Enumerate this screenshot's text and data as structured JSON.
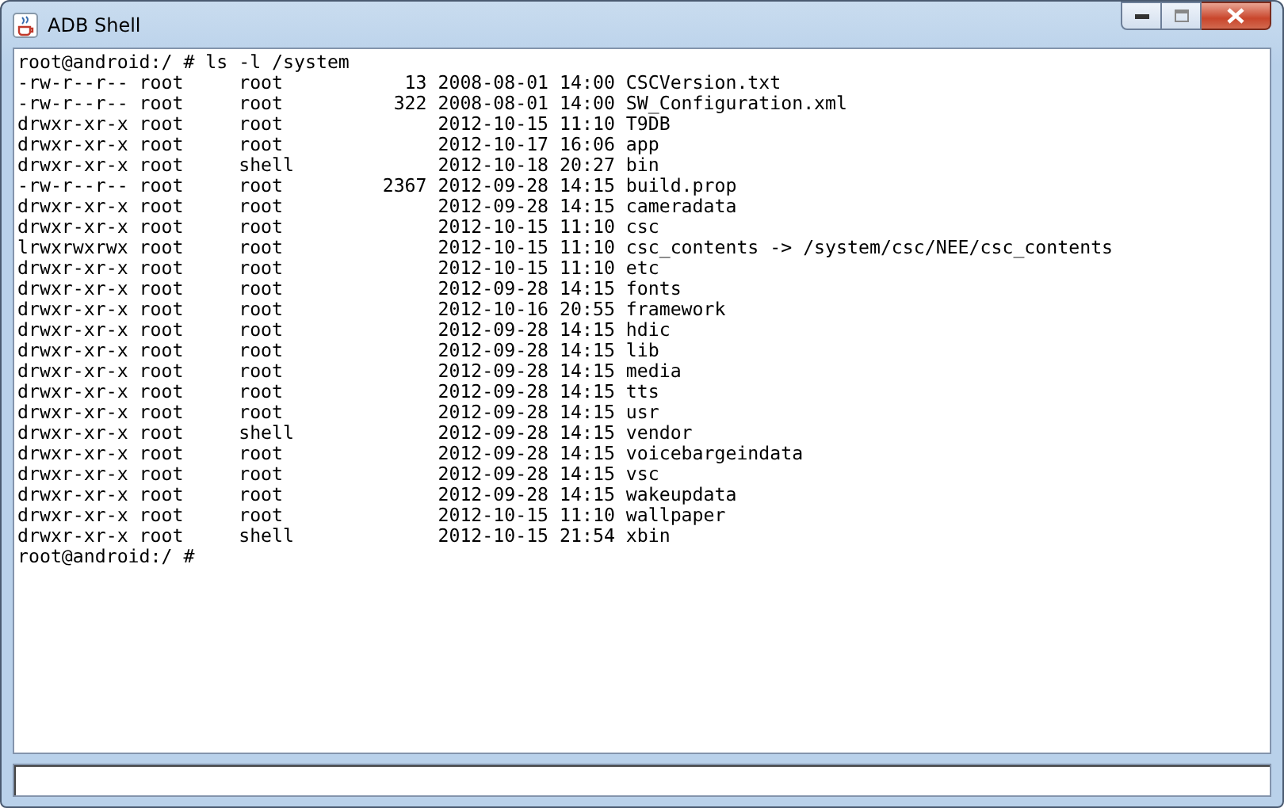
{
  "window": {
    "title": "ADB Shell"
  },
  "output": {
    "lines": [
      "root@android:/ # ls -l /system",
      "-rw-r--r-- root     root           13 2008-08-01 14:00 CSCVersion.txt",
      "-rw-r--r-- root     root          322 2008-08-01 14:00 SW_Configuration.xml",
      "drwxr-xr-x root     root              2012-10-15 11:10 T9DB",
      "drwxr-xr-x root     root              2012-10-17 16:06 app",
      "drwxr-xr-x root     shell             2012-10-18 20:27 bin",
      "-rw-r--r-- root     root         2367 2012-09-28 14:15 build.prop",
      "drwxr-xr-x root     root              2012-09-28 14:15 cameradata",
      "drwxr-xr-x root     root              2012-10-15 11:10 csc",
      "lrwxrwxrwx root     root              2012-10-15 11:10 csc_contents -> /system/csc/NEE/csc_contents",
      "drwxr-xr-x root     root              2012-10-15 11:10 etc",
      "drwxr-xr-x root     root              2012-09-28 14:15 fonts",
      "drwxr-xr-x root     root              2012-10-16 20:55 framework",
      "drwxr-xr-x root     root              2012-09-28 14:15 hdic",
      "drwxr-xr-x root     root              2012-09-28 14:15 lib",
      "drwxr-xr-x root     root              2012-09-28 14:15 media",
      "drwxr-xr-x root     root              2012-09-28 14:15 tts",
      "drwxr-xr-x root     root              2012-09-28 14:15 usr",
      "drwxr-xr-x root     shell             2012-09-28 14:15 vendor",
      "drwxr-xr-x root     root              2012-09-28 14:15 voicebargeindata",
      "drwxr-xr-x root     root              2012-09-28 14:15 vsc",
      "drwxr-xr-x root     root              2012-09-28 14:15 wakeupdata",
      "drwxr-xr-x root     root              2012-10-15 11:10 wallpaper",
      "drwxr-xr-x root     shell             2012-10-15 21:54 xbin",
      "root@android:/ #"
    ]
  }
}
